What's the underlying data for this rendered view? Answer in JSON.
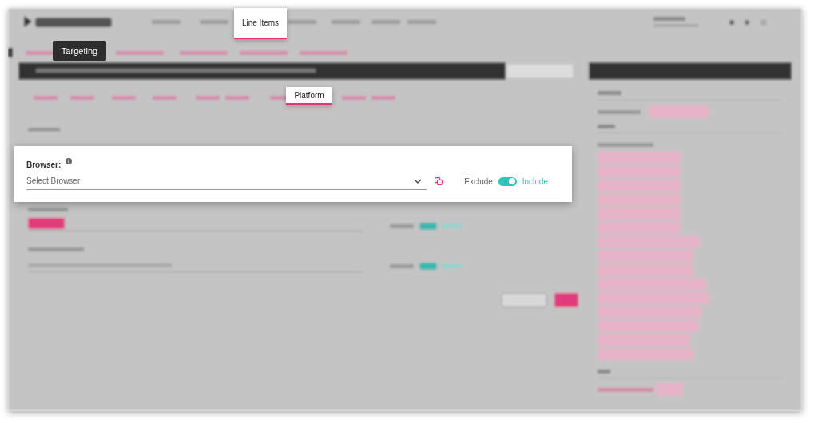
{
  "nav_highlight": {
    "label": "Line Items",
    "selected": true
  },
  "tooltip": {
    "label": "Targeting"
  },
  "tab_highlight": {
    "label": "Platform",
    "selected": true
  },
  "browser_filter": {
    "label": "Browser:",
    "placeholder": "Select Browser",
    "exclude_label": "Exclude",
    "include_label": "Include",
    "include": true
  }
}
